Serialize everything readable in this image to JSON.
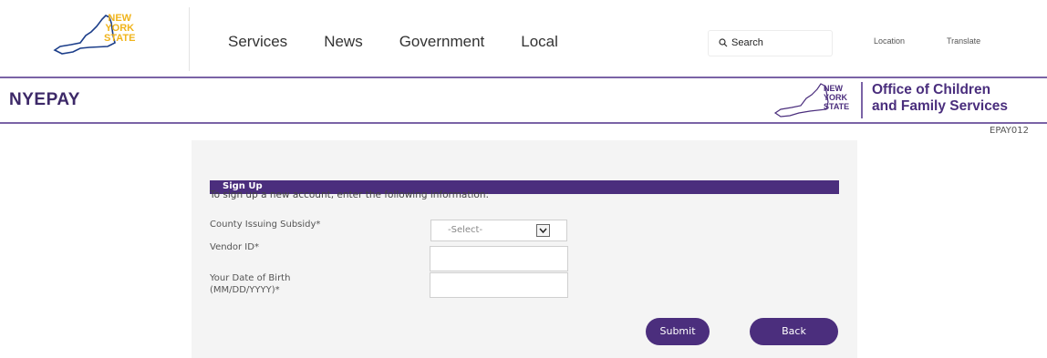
{
  "header": {
    "logo_lines": [
      "NEW",
      "YORK",
      "STATE"
    ],
    "nav": [
      "Services",
      "News",
      "Government",
      "Local"
    ],
    "search_placeholder": "Search",
    "utility_links": [
      "Location",
      "Translate"
    ]
  },
  "band": {
    "app_title": "NYEPAY",
    "logo_lines": [
      "NEW",
      "YORK",
      "STATE"
    ],
    "agency_line1": "Office of Children",
    "agency_line2": "and Family Services"
  },
  "page_code": "EPAY012",
  "form": {
    "heading": "Sign Up",
    "intro": "To sign up a new account, enter the following information:",
    "county_label": "County Issuing Subsidy*",
    "county_selected": "-Select-",
    "vendor_label": "Vendor ID*",
    "vendor_value": "",
    "dob_label_line1": "Your Date of Birth",
    "dob_label_line2": "(MM/DD/YYYY)*",
    "dob_value": "",
    "submit_label": "Submit",
    "back_label": "Back"
  },
  "colors": {
    "brand_purple": "#4b2e7d",
    "logo_gold": "#f0b41c"
  }
}
